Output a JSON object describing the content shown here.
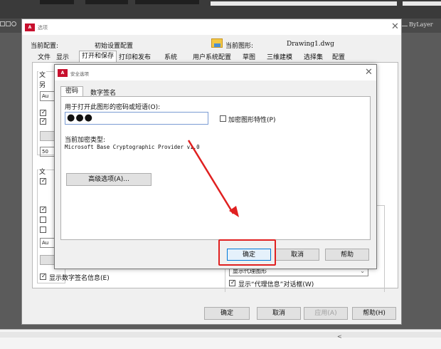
{
  "app": {
    "layer_combo_value": "ByLayer"
  },
  "options_dialog": {
    "title": "选项",
    "profile_label": "当前配置:",
    "profile_value": "初始设置配置",
    "drawing_label": "当前图形:",
    "drawing_value": "Drawing1.dwg",
    "tabs": [
      "文件",
      "显示",
      "打开和保存",
      "打印和发布",
      "系统",
      "用户系统配置",
      "草图",
      "三维建模",
      "选择集",
      "配置"
    ],
    "active_tab": "打开和保存",
    "partial_labels": [
      "文",
      "另",
      "文"
    ],
    "partial_box_text": "Au",
    "partial_num_text": "50",
    "show_signature_label": "显示数字签名信息(E)",
    "proxy_combo_value": "显示代理图形",
    "proxy_dialog_label": "显示“代理信息”对话框(W)",
    "buttons": {
      "ok": "确定",
      "cancel": "取消",
      "apply": "应用(A)",
      "help": "帮助(H)"
    }
  },
  "security_dialog": {
    "title": "安全选项",
    "tabs": [
      "密码",
      "数字签名"
    ],
    "active_tab": "密码",
    "password_label": "用于打开此图形的密码或短语(O):",
    "password_value": "●●●",
    "encrypt_props_label": "加密图形特性(P)",
    "encryption_type_label": "当前加密类型:",
    "encryption_type_value": "Microsoft Base Cryptographic Provider v1.0",
    "advanced_button": "高级选项(A)...",
    "buttons": {
      "ok": "确定",
      "cancel": "取消",
      "help": "帮助"
    }
  },
  "annotation": {
    "arrow_color": "#e02020",
    "highlight_color": "#e02020"
  },
  "statusbar": {
    "chevron": "<"
  }
}
